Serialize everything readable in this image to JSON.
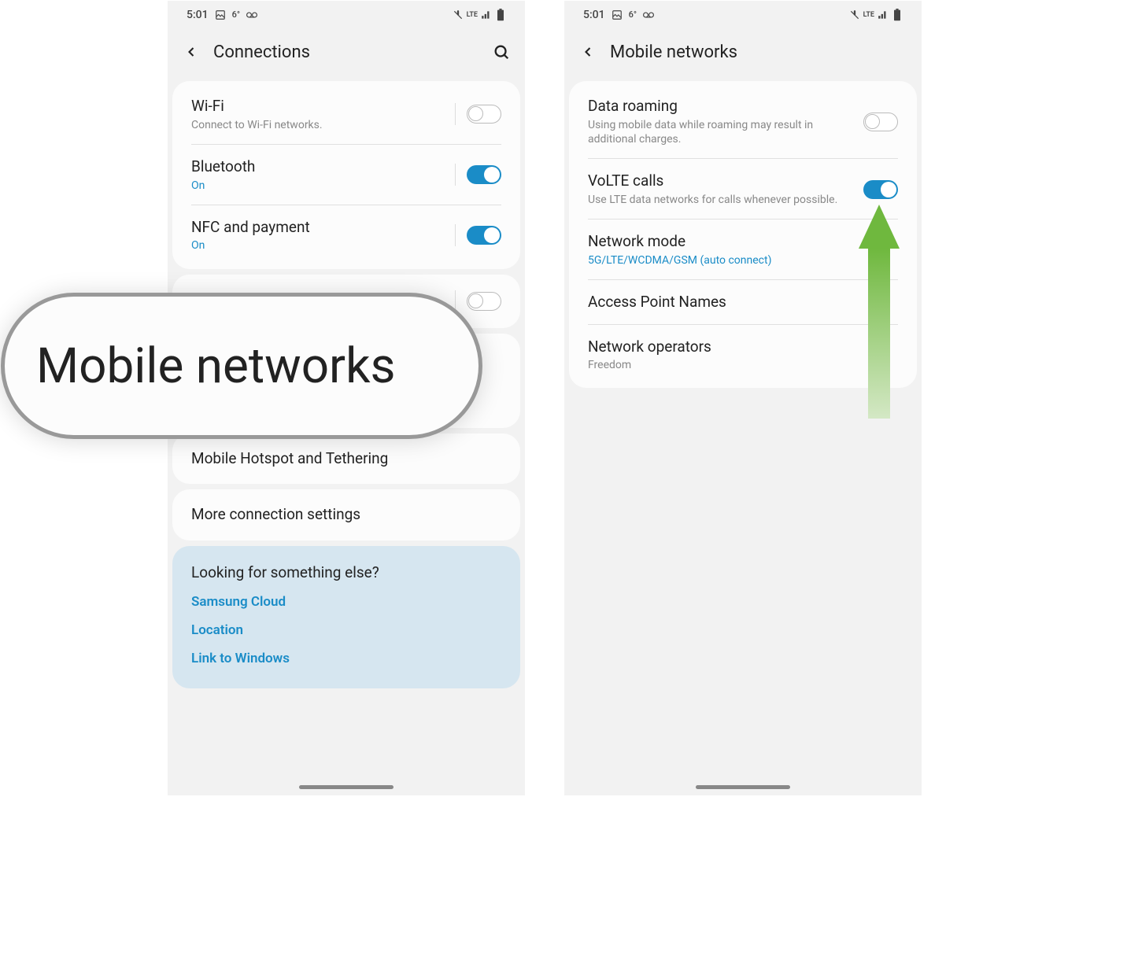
{
  "status": {
    "time": "5:01",
    "temp": "6°",
    "lte_label": "LTE"
  },
  "left": {
    "header_title": "Connections",
    "wifi": {
      "title": "Wi-Fi",
      "subtitle": "Connect to Wi-Fi networks."
    },
    "bluetooth": {
      "title": "Bluetooth",
      "subtitle": "On"
    },
    "nfc": {
      "title": "NFC and payment",
      "subtitle": "On"
    },
    "hotspot": {
      "title": "Mobile Hotspot and Tethering"
    },
    "more": {
      "title": "More connection settings"
    },
    "suggest": {
      "title": "Looking for something else?",
      "links": [
        "Samsung Cloud",
        "Location",
        "Link to Windows"
      ]
    }
  },
  "right": {
    "header_title": "Mobile networks",
    "roaming": {
      "title": "Data roaming",
      "subtitle": "Using mobile data while roaming may result in additional charges."
    },
    "volte": {
      "title": "VoLTE calls",
      "subtitle": "Use LTE data networks for calls whenever possible."
    },
    "network_mode": {
      "title": "Network mode",
      "subtitle": "5G/LTE/WCDMA/GSM (auto connect)"
    },
    "apn": {
      "title": "Access Point Names"
    },
    "operators": {
      "title": "Network operators",
      "subtitle": "Freedom"
    }
  },
  "callout": {
    "text": "Mobile networks"
  }
}
